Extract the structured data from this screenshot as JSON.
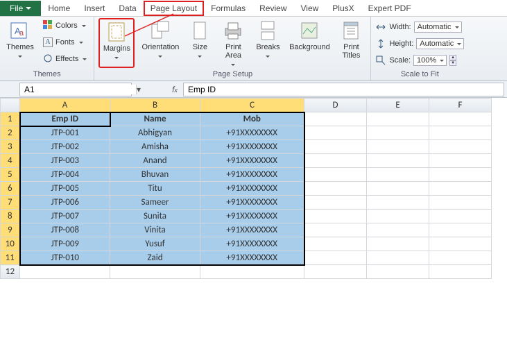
{
  "tabs": {
    "file": "File",
    "items": [
      "Home",
      "Insert",
      "Data",
      "Page Layout",
      "Formulas",
      "Review",
      "View",
      "PlusX",
      "Expert PDF"
    ]
  },
  "ribbon": {
    "themes": {
      "label": "Themes",
      "themes_btn": "Themes",
      "colors": "Colors",
      "fonts": "Fonts",
      "effects": "Effects"
    },
    "page_setup": {
      "label": "Page Setup",
      "margins": "Margins",
      "orientation": "Orientation",
      "size": "Size",
      "print_area": "Print\nArea",
      "breaks": "Breaks",
      "background": "Background",
      "print_titles": "Print\nTitles"
    },
    "scale": {
      "label": "Scale to Fit",
      "width": "Width:",
      "height": "Height:",
      "scale": "Scale:",
      "width_val": "Automatic",
      "height_val": "Automatic",
      "scale_val": "100%"
    }
  },
  "namebox": "A1",
  "formula": "Emp ID",
  "columns": [
    "A",
    "B",
    "C",
    "D",
    "E",
    "F"
  ],
  "header_row": [
    "Emp ID",
    "Name",
    "Mob"
  ],
  "rows": [
    [
      "JTP-001",
      "Abhigyan",
      "+91XXXXXXXX"
    ],
    [
      "JTP-002",
      "Amisha",
      "+91XXXXXXXX"
    ],
    [
      "JTP-003",
      "Anand",
      "+91XXXXXXXX"
    ],
    [
      "JTP-004",
      "Bhuvan",
      "+91XXXXXXXX"
    ],
    [
      "JTP-005",
      "Titu",
      "+91XXXXXXXX"
    ],
    [
      "JTP-006",
      "Sameer",
      "+91XXXXXXXX"
    ],
    [
      "JTP-007",
      "Sunita",
      "+91XXXXXXXX"
    ],
    [
      "JTP-008",
      "Vinita",
      "+91XXXXXXXX"
    ],
    [
      "JTP-009",
      "Yusuf",
      "+91XXXXXXXX"
    ],
    [
      "JTP-010",
      "Zaid",
      "+91XXXXXXXX"
    ]
  ]
}
